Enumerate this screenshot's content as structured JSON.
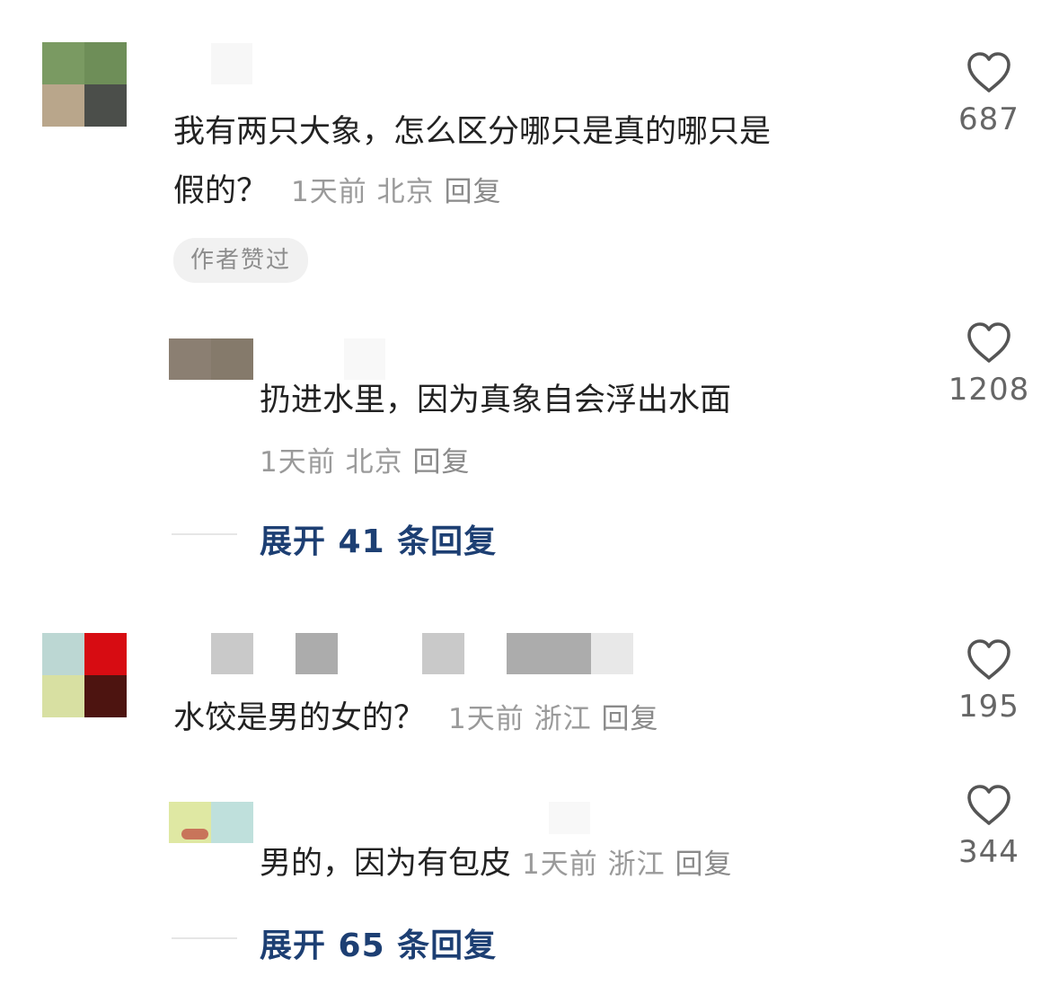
{
  "comments": [
    {
      "text_line1": "我有两只大象，怎么区分哪只是真的哪只是",
      "text_line2": "假的？",
      "time": "1天前",
      "location": "北京",
      "reply_label": "回复",
      "badge": "作者赞过",
      "likes": "687",
      "reply": {
        "text": "扔进水里，因为真象自会浮出水面",
        "time": "1天前",
        "location": "北京",
        "reply_label": "回复",
        "likes": "1208"
      },
      "expand_label": "展开 41 条回复"
    },
    {
      "text": "水饺是男的女的？",
      "time": "1天前",
      "location": "浙江",
      "reply_label": "回复",
      "likes": "195",
      "reply": {
        "text": "男的，因为有包皮",
        "time": "1天前",
        "location": "浙江",
        "reply_label": "回复",
        "likes": "344"
      },
      "expand_label": "展开 65 条回复"
    }
  ],
  "colors": {
    "expand_link": "#1d3f73",
    "meta_text": "#9a9a9a",
    "badge_bg": "#f1f1f1",
    "heart_outline": "#555555"
  },
  "icons": [
    "heart-icon"
  ]
}
